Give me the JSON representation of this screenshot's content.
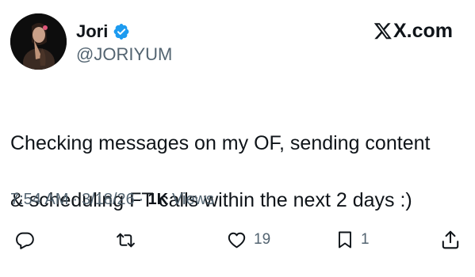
{
  "author": {
    "display_name": "Jori",
    "handle": "@JORIYUM",
    "verified": true,
    "avatar_icon": "profile-photo"
  },
  "brand": {
    "domain": "X.com",
    "icon": "x-logo-icon"
  },
  "tweet": {
    "text_line_1": "Checking messages on my OF, sending content",
    "text_line_2": "& scheduling FT calls within the next 2 days :)"
  },
  "meta": {
    "time": "7:54 AM",
    "separator_1": "·",
    "date": "3/18/26",
    "separator_2": "·",
    "views_count": "1K",
    "views_label": "Views"
  },
  "actions": {
    "reply": {
      "icon": "reply-icon",
      "count": ""
    },
    "repost": {
      "icon": "repost-icon",
      "count": ""
    },
    "like": {
      "icon": "heart-icon",
      "count": "19"
    },
    "bookmark": {
      "icon": "bookmark-icon",
      "count": "1"
    },
    "share": {
      "icon": "share-icon",
      "count": ""
    }
  },
  "colors": {
    "text_primary": "#0f1419",
    "text_secondary": "#536471",
    "verified_blue": "#1d9bf0",
    "background": "#ffffff"
  }
}
